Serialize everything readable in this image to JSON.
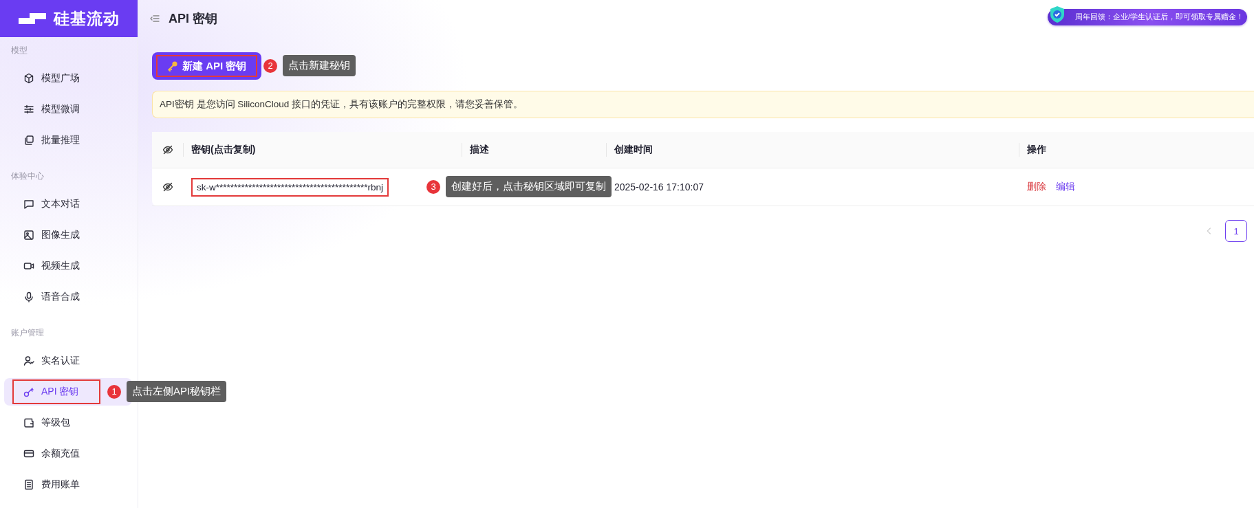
{
  "brand": {
    "name": "硅基流动"
  },
  "sidebar": {
    "sections": [
      {
        "title": "模型",
        "items": [
          {
            "label": "模型广场",
            "selected": false
          },
          {
            "label": "模型微调",
            "selected": false
          },
          {
            "label": "批量推理",
            "selected": false
          }
        ]
      },
      {
        "title": "体验中心",
        "items": [
          {
            "label": "文本对话",
            "selected": false
          },
          {
            "label": "图像生成",
            "selected": false
          },
          {
            "label": "视频生成",
            "selected": false
          },
          {
            "label": "语音合成",
            "selected": false
          }
        ]
      },
      {
        "title": "账户管理",
        "items": [
          {
            "label": "实名认证",
            "selected": false
          },
          {
            "label": "API 密钥",
            "selected": true,
            "highlight": {
              "number": "1",
              "text": "点击左侧API秘钥栏"
            }
          },
          {
            "label": "等级包",
            "selected": false
          },
          {
            "label": "余额充值",
            "selected": false
          },
          {
            "label": "费用账单",
            "selected": false
          }
        ]
      }
    ]
  },
  "header": {
    "title": "API 密钥",
    "promo": "周年回馈：企业/学生认证后，即可领取专属赠金！"
  },
  "new_key_button": {
    "label": "新建 API 密钥",
    "highlight": {
      "number": "2",
      "text": "点击新建秘钥"
    }
  },
  "notice": "API密钥 是您访问 SiliconCloud 接口的凭证，具有该账户的完整权限，请您妥善保管。",
  "table": {
    "columns": [
      "密钥(点击复制)",
      "描述",
      "创建时间",
      "操作"
    ],
    "rows": [
      {
        "key": "sk-w******************************************rbnj",
        "key_highlight": {
          "number": "3",
          "text": "创建好后，点击秘钥区域即可复制"
        },
        "created": "2025-02-16 17:10:07",
        "actions": [
          {
            "label": "删除",
            "kind": "danger"
          },
          {
            "label": "编辑",
            "kind": "link"
          }
        ]
      }
    ]
  },
  "pagination": {
    "prev_disabled": true,
    "pages": [
      {
        "label": "1",
        "selected": true
      }
    ]
  }
}
